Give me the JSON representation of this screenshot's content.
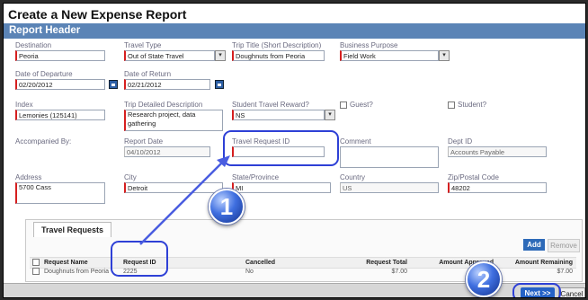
{
  "page_title": "Create a New Expense Report",
  "section_title": "Report Header",
  "fields": {
    "destination": {
      "label": "Destination",
      "value": "Peoria"
    },
    "travel_type": {
      "label": "Travel Type",
      "value": "Out of State Travel"
    },
    "trip_title": {
      "label": "Trip Title (Short Description)",
      "value": "Doughnuts from Peoria"
    },
    "business_purpose": {
      "label": "Business Purpose",
      "value": "Field Work"
    },
    "date_of_departure": {
      "label": "Date of Departure",
      "value": "02/20/2012"
    },
    "date_of_return": {
      "label": "Date of Return",
      "value": "02/21/2012"
    },
    "index": {
      "label": "Index",
      "value": "Lemonies (125141)"
    },
    "trip_detailed_description": {
      "label": "Trip Detailed Description",
      "value": "Research project, data gathering"
    },
    "student_travel_reward": {
      "label": "Student Travel Reward?",
      "value": "NS"
    },
    "guest": {
      "label": "Guest?"
    },
    "student": {
      "label": "Student?"
    },
    "accompanied_by": {
      "label": "Accompanied By:",
      "value": ""
    },
    "report_date": {
      "label": "Report Date",
      "value": "04/10/2012"
    },
    "travel_request_id": {
      "label": "Travel Request ID",
      "value": ""
    },
    "comment": {
      "label": "Comment",
      "value": ""
    },
    "dept_id": {
      "label": "Dept ID",
      "value": "Accounts Payable"
    },
    "address": {
      "label": "Address",
      "value": "5700 Cass"
    },
    "city": {
      "label": "City",
      "value": "Detroit"
    },
    "state_province": {
      "label": "State/Province",
      "value": "MI"
    },
    "country": {
      "label": "Country",
      "value": "US"
    },
    "zip_postal_code": {
      "label": "Zip/Postal Code",
      "value": "48202"
    }
  },
  "travel_requests": {
    "tab_label": "Travel Requests",
    "add_label": "Add",
    "remove_label": "Remove",
    "columns": [
      "Request Name",
      "Request ID",
      "Cancelled",
      "Request Total",
      "Amount Approved",
      "Amount Remaining"
    ],
    "rows": [
      {
        "name": "Doughnuts from Peoria",
        "id": "2225",
        "cancelled": "No",
        "total": "$7.00",
        "approved": "",
        "remaining": "$7.00"
      }
    ]
  },
  "callouts": {
    "one": "1",
    "two": "2"
  },
  "buttons": {
    "next": "Next >>",
    "cancel": "Cancel"
  },
  "colors": {
    "header_bar": "#5b84b6",
    "required_marker": "#d61f1f",
    "callout": "#2e40d6",
    "primary_button": "#2562c6"
  },
  "icons": {
    "calendar": "calendar-icon",
    "dropdown": "chevron-down-icon",
    "arrow": "pointer-arrow"
  }
}
